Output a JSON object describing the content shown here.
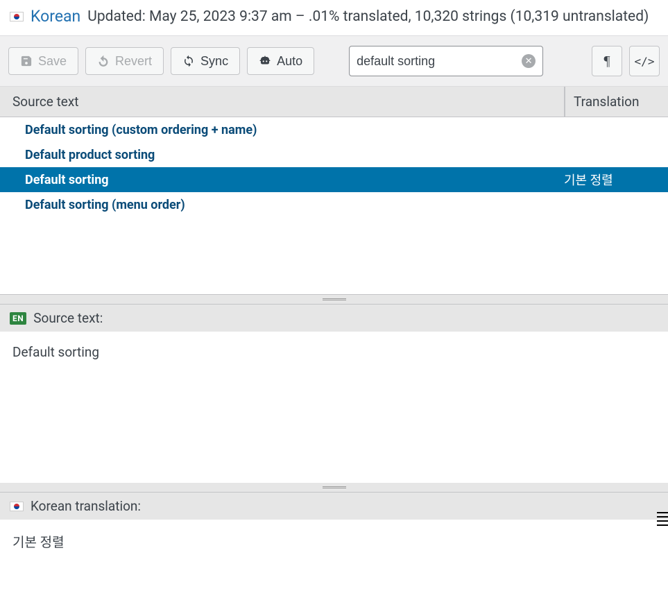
{
  "header": {
    "language": "Korean",
    "info": "Updated: May 25, 2023 9:37 am – .01% translated, 10,320 strings (10,319 untranslated)"
  },
  "toolbar": {
    "save": "Save",
    "revert": "Revert",
    "sync": "Sync",
    "auto": "Auto",
    "search_value": "default sorting",
    "pilcrow": "¶",
    "code": "</>"
  },
  "columns": {
    "source": "Source text",
    "translation": "Translation"
  },
  "rows": [
    {
      "source": "Default sorting (custom ordering + name)",
      "translation": "",
      "selected": false
    },
    {
      "source": "Default product sorting",
      "translation": "",
      "selected": false
    },
    {
      "source": "Default sorting",
      "translation": "기본 정렬",
      "selected": true
    },
    {
      "source": "Default sorting (menu order)",
      "translation": "",
      "selected": false
    }
  ],
  "sourcePanel": {
    "badge": "EN",
    "label": "Source text:",
    "content": "Default sorting"
  },
  "translationPanel": {
    "label": "Korean translation:",
    "content": "기본 정렬"
  }
}
